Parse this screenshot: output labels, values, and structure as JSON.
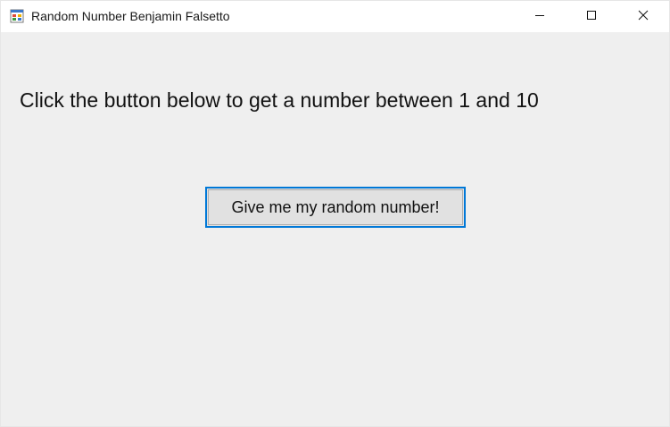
{
  "window": {
    "title": "Random Number Benjamin Falsetto",
    "app_icon": "windows-form-icon",
    "controls": {
      "minimize_icon": "minimize-icon",
      "maximize_icon": "maximize-icon",
      "close_icon": "close-icon"
    }
  },
  "main": {
    "instruction": "Click the button below to get a number between 1 and 10",
    "button_label": "Give me my random number!"
  },
  "colors": {
    "accent": "#0078d7",
    "background": "#efefef",
    "button_face": "#e1e1e1"
  }
}
